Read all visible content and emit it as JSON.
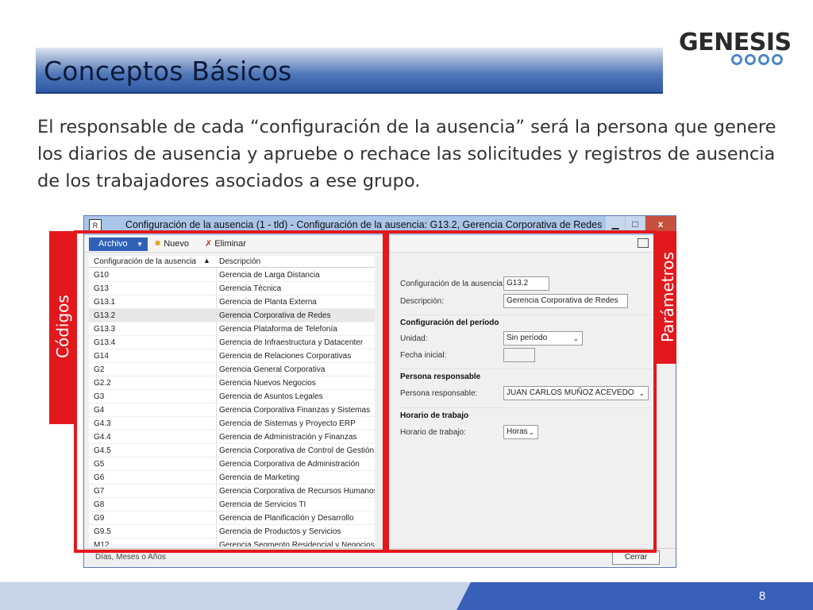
{
  "slide": {
    "title": "Conceptos Básicos",
    "logo_text": "GENESIS",
    "body": "El responsable  de cada “configuración de la ausencia” será la persona que genere los diarios de ausencia y apruebe o rechace las solicitudes y registros de ausencia de los trabajadores asociados a ese grupo.",
    "page_number": "8"
  },
  "window": {
    "title": "Configuración de la ausencia (1 - tld) - Configuración de la ausencia: G13.2, Gerencia Corporativa de Redes",
    "app_icon": "R",
    "minimize": "▁",
    "maximize": "□",
    "close": "x"
  },
  "toolbar": {
    "file_label": "Archivo",
    "new_label": "Nuevo",
    "delete_label": "Eliminar"
  },
  "grid": {
    "col1": "Configuración de la ausencia",
    "col2": "Descripción",
    "rows": [
      {
        "code": "G10",
        "desc": "Gerencia de Larga Distancia"
      },
      {
        "code": "G13",
        "desc": "Gerencia Técnica"
      },
      {
        "code": "G13.1",
        "desc": "Gerencia de Planta Externa"
      },
      {
        "code": "G13.2",
        "desc": "Gerencia Corporativa de Redes"
      },
      {
        "code": "G13.3",
        "desc": "Gerencia Plataforma de Telefonía"
      },
      {
        "code": "G13.4",
        "desc": "Gerencia de Infraestructura y Datacenter"
      },
      {
        "code": "G14",
        "desc": "Gerencia de Relaciones Corporativas"
      },
      {
        "code": "G2",
        "desc": "Gerencia General Corporativa"
      },
      {
        "code": "G2.2",
        "desc": "Gerencia Nuevos Negocios"
      },
      {
        "code": "G3",
        "desc": "Gerencia de Asuntos Legales"
      },
      {
        "code": "G4",
        "desc": "Gerencia Corporativa Finanzas y Sistemas"
      },
      {
        "code": "G4.3",
        "desc": "Gerencia de Sistemas y Proyecto ERP"
      },
      {
        "code": "G4.4",
        "desc": "Gerencia de Administración y Finanzas"
      },
      {
        "code": "G4.5",
        "desc": "Gerencia Corporativa de Control de Gestión"
      },
      {
        "code": "G5",
        "desc": "Gerencia Corporativa de Administración"
      },
      {
        "code": "G6",
        "desc": "Gerencia de Marketing"
      },
      {
        "code": "G7",
        "desc": "Gerencia Corporativa de Recursos Humanos"
      },
      {
        "code": "G8",
        "desc": "Gerencia de Servicios TI"
      },
      {
        "code": "G9",
        "desc": "Gerencia de Planificación y Desarrollo"
      },
      {
        "code": "G9.5",
        "desc": "Gerencia de Productos y Servicios"
      },
      {
        "code": "M12",
        "desc": "Gerencia Segmento Residencial y Negocios"
      }
    ],
    "selected_row": 3
  },
  "details": {
    "config_label": "Configuración de la ausencia:",
    "config_value": "G13.2",
    "desc_label": "Descripción:",
    "desc_value": "Gerencia Corporativa de Redes",
    "period_section": "Configuración del período",
    "unit_label": "Unidad:",
    "unit_value": "Sin período",
    "start_label": "Fecha inicial:",
    "start_value": "",
    "responsible_section": "Persona responsable",
    "responsible_label": "Persona responsable:",
    "responsible_value": "JUAN CARLOS MUÑOZ ACEVEDO",
    "schedule_section": "Horario de trabajo",
    "schedule_label": "Horario de trabajo:",
    "schedule_value": "Horas"
  },
  "status": {
    "text": "Días, Meses o Años",
    "close_button": "Cerrar"
  },
  "annotations": {
    "left_tag": "Códigos",
    "right_tag": "Parámetros"
  },
  "colors": {
    "annotation_red": "#e3181d",
    "title_blue": "#2f58a5",
    "footer_blue": "#3a5fb8"
  }
}
